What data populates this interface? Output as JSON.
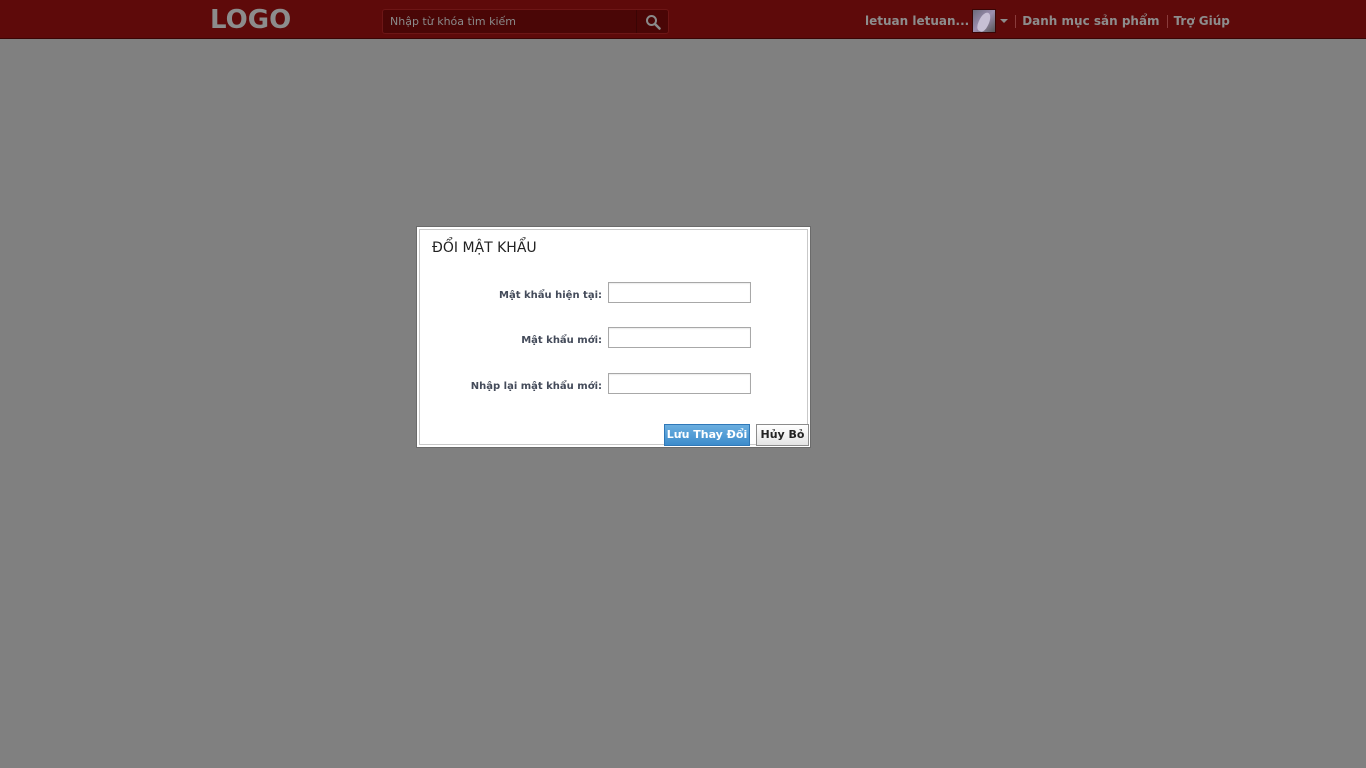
{
  "header": {
    "logo": "LOGO",
    "search_placeholder": "Nhập từ khóa tìm kiếm",
    "search_icon": "search-icon",
    "user_name": "letuan letuan...",
    "nav_categories": "Danh mục sản phẩm",
    "nav_help": "Trợ Giúp"
  },
  "dialog": {
    "title": "ĐỔI MẬT KHẨU",
    "fields": [
      {
        "label": "Mật khẩu hiện tại:",
        "value": ""
      },
      {
        "label": "Mật khẩu mới:",
        "value": ""
      },
      {
        "label": "Nhập lại mật khẩu mới:",
        "value": ""
      }
    ],
    "save_label": "Lưu Thay Đổi",
    "cancel_label": "Hủy Bỏ"
  },
  "colors": {
    "header_bg": "#5e0a0a",
    "page_bg": "#808080",
    "primary_button": "#3d8ccc"
  }
}
